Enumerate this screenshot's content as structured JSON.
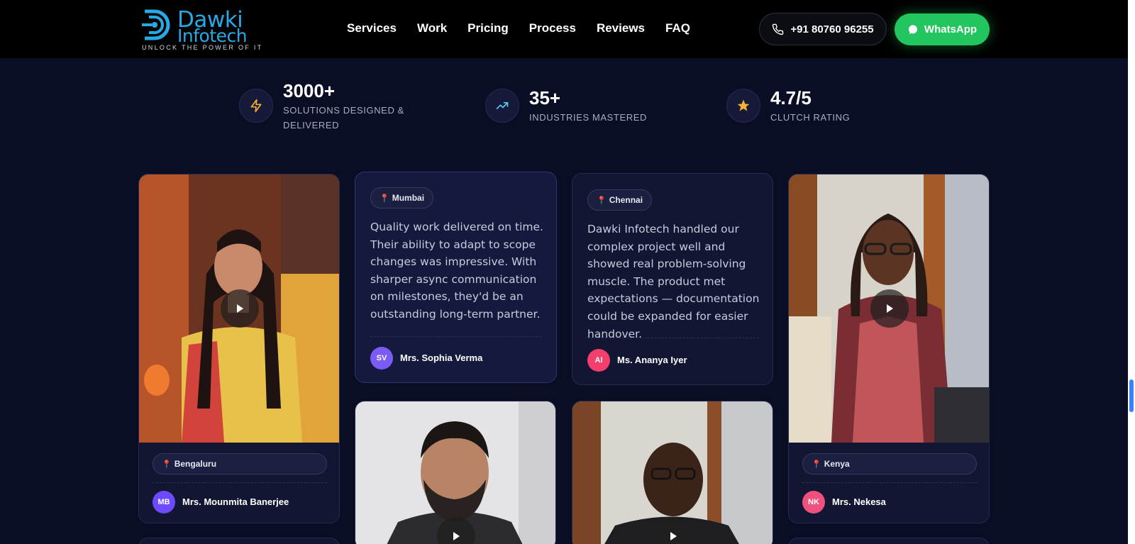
{
  "brand": {
    "name_line1": "Dawki",
    "name_line2": "Infotech",
    "tagline": "UNLOCK THE POWER OF IT",
    "color": "#27a9e6"
  },
  "nav": {
    "items": [
      "Services",
      "Work",
      "Pricing",
      "Process",
      "Reviews",
      "FAQ"
    ],
    "phone": "+91 80760 96255",
    "whatsapp_label": "WhatsApp",
    "whatsapp_color": "#22c55e"
  },
  "stats": [
    {
      "value": "3000+",
      "label": "SOLUTIONS DESIGNED & DELIVERED",
      "icon": "lightning-icon"
    },
    {
      "value": "35+",
      "label": "INDUSTRIES MASTERED",
      "icon": "trending-up-icon"
    },
    {
      "value": "4.7/5",
      "label": "CLUTCH RATING",
      "icon": "star-icon"
    }
  ],
  "testimonials": {
    "bengaluru": {
      "location": "Bengaluru",
      "initials": "MB",
      "name": "Mrs. Mounmita Banerjee",
      "avatar_color": "#6d4aff"
    },
    "mumbai": {
      "location": "Mumbai",
      "quote": "Quality work delivered on time. Their ability to adapt to scope changes was impressive. With sharper async communication on milestones, they'd be an outstanding long-term partner.",
      "initials": "SV",
      "name": "Mrs. Sophia Verma",
      "avatar_color": "#7a5cf5"
    },
    "chennai": {
      "location": "Chennai",
      "quote": "Dawki Infotech handled our complex project well and showed real problem-solving muscle. The product met expectations — documentation could be expanded for easier handover.",
      "initials": "AI",
      "name": "Ms. Ananya Iyer",
      "avatar_color": "#f43f6e"
    },
    "kenya": {
      "location": "Kenya",
      "initials": "NK",
      "name": "Mrs. Nekesa",
      "avatar_color": "#f0507e"
    }
  }
}
